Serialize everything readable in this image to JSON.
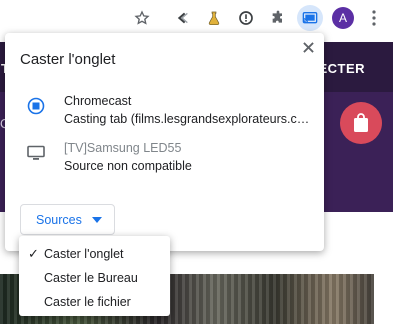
{
  "toolbar": {
    "icons": [
      "star-icon",
      "extension-c-icon",
      "flask-icon",
      "info-alert-icon",
      "puzzle-icon",
      "cast-icon",
      "avatar",
      "kebab-menu-icon"
    ],
    "avatar_initial": "A",
    "cast_highlight_color": "#d6e6fb",
    "avatar_color": "#5b2fa4"
  },
  "site": {
    "nav_cta": "ECTER",
    "nav_partial": "T",
    "hero_partial": "Q",
    "nav_color": "#2b1a3f",
    "hero_color": "#3b2157",
    "bag_color": "#d94a5b"
  },
  "dialog": {
    "title": "Caster l'onglet",
    "close_icon": "close-icon",
    "sinks": [
      {
        "name": "Chromecast",
        "status": "Casting tab (films.lesgrandsexplorateurs.com)",
        "icon": "cast-connected-icon",
        "enabled": true
      },
      {
        "name": "[TV]Samsung LED55",
        "status": "Source non compatible",
        "icon": "monitor-icon",
        "enabled": false
      }
    ],
    "sources_label": "Sources"
  },
  "sources_menu": {
    "items": [
      {
        "label": "Caster l'onglet",
        "checked": true
      },
      {
        "label": "Caster le Bureau",
        "checked": false
      },
      {
        "label": "Caster le fichier",
        "checked": false
      }
    ],
    "check_glyph": "✓"
  },
  "colors": {
    "accent": "#1a73e8",
    "text": "#202124",
    "muted": "#80868b"
  }
}
